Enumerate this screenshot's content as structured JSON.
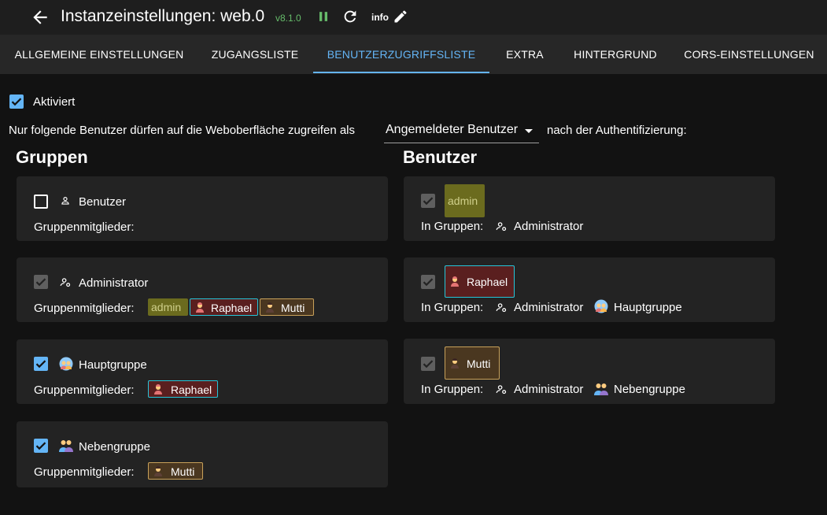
{
  "header": {
    "title": "Instanzeinstellungen: web.0",
    "version": "v8.1.0",
    "info_label": "info"
  },
  "tabs": [
    {
      "label": "ALLGEMEINE EINSTELLUNGEN"
    },
    {
      "label": "ZUGANGSLISTE"
    },
    {
      "label": "BENUTZERZUGRIFFSLISTE",
      "active": true
    },
    {
      "label": "EXTRA"
    },
    {
      "label": "HINTERGRUND"
    },
    {
      "label": "CORS-EINSTELLUNGEN"
    }
  ],
  "enabled": {
    "label": "Aktiviert",
    "checked": true
  },
  "access_sentence": {
    "prefix": "Nur folgende Benutzer dürfen auf die Weboberfläche zugreifen als",
    "select_value": "Angemeldeter Benutzer",
    "suffix": "nach der Authentifizierung:"
  },
  "groups_title": "Gruppen",
  "users_title": "Benutzer",
  "members_label": "Gruppenmitglieder:",
  "in_groups_label": "In Gruppen:",
  "groups": [
    {
      "name": "Benutzer",
      "checked": false,
      "members": []
    },
    {
      "name": "Administrator",
      "checked": true,
      "disabled": true,
      "members": [
        "admin",
        "Raphael",
        "Mutti"
      ]
    },
    {
      "name": "Hauptgruppe",
      "checked": true,
      "members": [
        "Raphael"
      ]
    },
    {
      "name": "Nebengruppe",
      "checked": true,
      "members": [
        "Mutti"
      ]
    }
  ],
  "users": [
    {
      "name": "admin",
      "color": "#6b6b1e",
      "groups": [
        "Administrator"
      ]
    },
    {
      "name": "Raphael",
      "color": "#5a1f1f",
      "groups": [
        "Administrator",
        "Hauptgruppe"
      ]
    },
    {
      "name": "Mutti",
      "color": "#4a3720",
      "groups": [
        "Administrator",
        "Nebengruppe"
      ]
    }
  ],
  "colors": {
    "accent": "#64b5f6",
    "admin_chip": "#6b6b1e",
    "raphael_chip": "#5a1f1f",
    "mutti_chip": "#4a3720",
    "raphael_border": "#26c6da",
    "version_green": "#66bb6a"
  },
  "icons": {
    "back": "arrow-left-icon",
    "pause": "pause-icon",
    "refresh": "refresh-icon",
    "edit": "pencil-icon",
    "user_group": "person-icon",
    "admin_group": "people-gear-icon",
    "main_group": "group-avatar-icon",
    "side_group": "two-people-icon"
  }
}
